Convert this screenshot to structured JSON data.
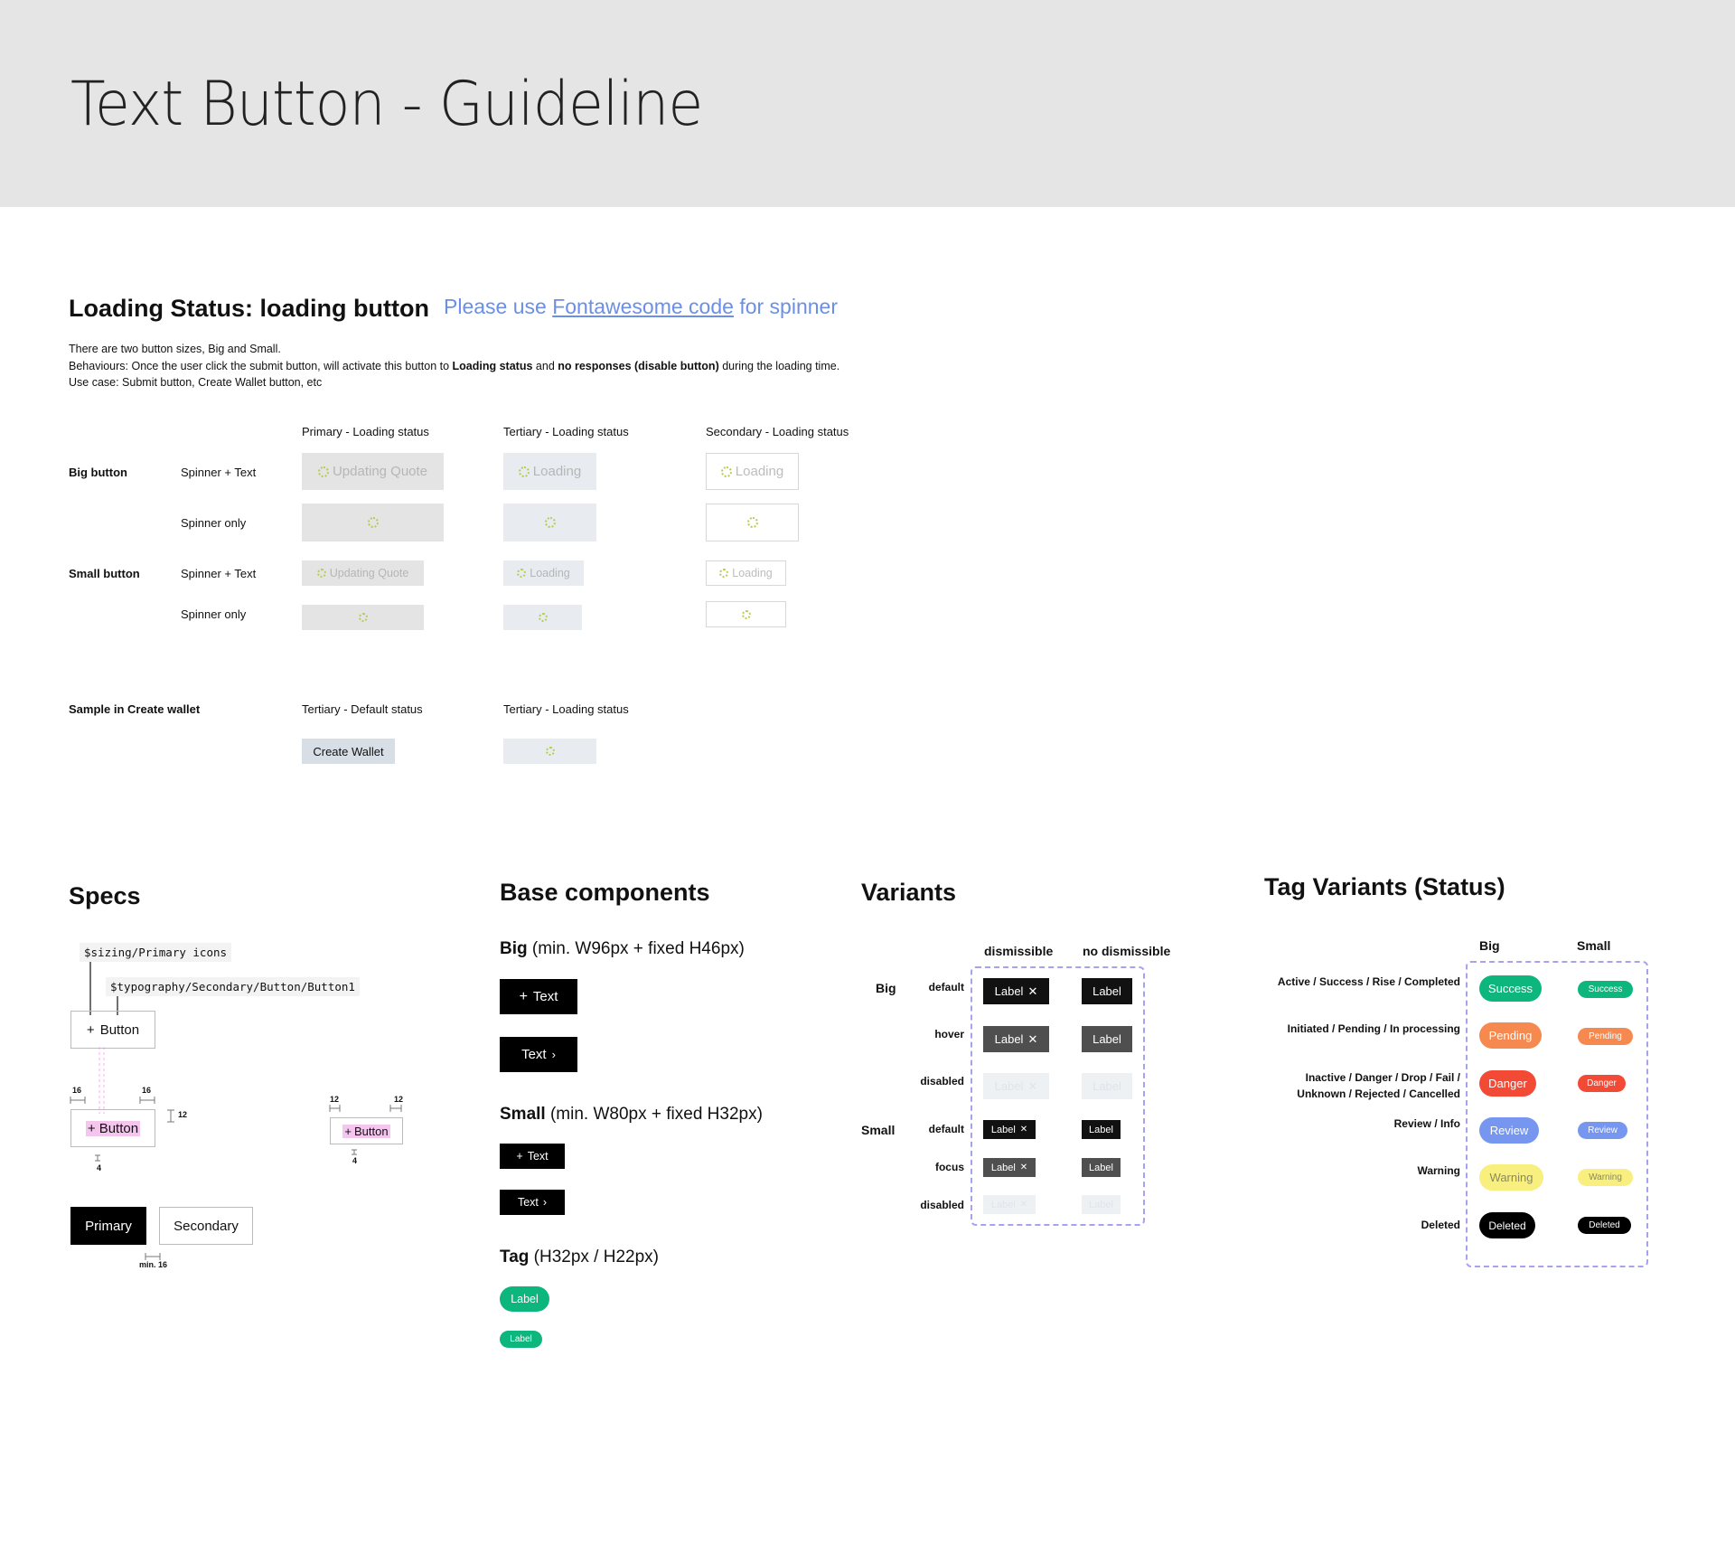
{
  "page_title": "Text Button - Guideline",
  "loading": {
    "title": "Loading Status: loading button",
    "note_prefix": "Please use ",
    "note_link": "Fontawesome code",
    "note_suffix": " for spinner",
    "desc1": "There are two button sizes, Big and Small.",
    "desc2_a": "Behaviours: Once the user click the submit button, will activate this button to ",
    "desc2_b": "Loading status",
    "desc2_c": " and ",
    "desc2_d": "no responses (disable button)",
    "desc2_e": " during the loading time.",
    "desc3": "Use case: Submit button, Create Wallet button, etc",
    "col_primary": "Primary - Loading status",
    "col_tertiary": "Tertiary - Loading status",
    "col_secondary": "Secondary - Loading status",
    "big_button": "Big button",
    "small_button": "Small button",
    "spinner_text": "Spinner + Text",
    "spinner_only": "Spinner only",
    "updating_quote": "Updating Quote",
    "loading_label": "Loading",
    "sample_label": "Sample in Create wallet",
    "col_tertiary_default": "Tertiary - Default status",
    "col_tertiary_loading": "Tertiary - Loading status",
    "create_wallet": "Create Wallet"
  },
  "specs": {
    "title": "Specs",
    "token_icons": "$sizing/Primary icons",
    "token_typography": "$typography/Secondary/Button/Button1",
    "button_label": "Button",
    "plus": "+",
    "dim_16": "16",
    "dim_12": "12",
    "dim_4": "4",
    "primary": "Primary",
    "secondary": "Secondary",
    "min16": "min. 16"
  },
  "base": {
    "title": "Base components",
    "big_title": "Big",
    "big_note": " (min. W96px + fixed H46px)",
    "small_title": "Small",
    "small_note": " (min. W80px + fixed H32px)",
    "tag_title": "Tag",
    "tag_note": " (H32px / H22px)",
    "text": "Text",
    "plus_text": "Text",
    "label": "Label"
  },
  "variants": {
    "title": "Variants",
    "dismissible": "dismissible",
    "no_dismissible": "no dismissible",
    "big": "Big",
    "small": "Small",
    "default": "default",
    "hover": "hover",
    "disabled": "disabled",
    "focus": "focus",
    "label": "Label"
  },
  "tags": {
    "title": "Tag Variants (Status)",
    "big": "Big",
    "small": "Small",
    "rows": [
      {
        "desc": "Active / Success / Rise / Completed",
        "label": "Success",
        "bg": "#0db67c",
        "fg": "#ffffff"
      },
      {
        "desc": "Initiated / Pending / In processing",
        "label": "Pending",
        "bg": "#f5894f",
        "fg": "#ffffff"
      },
      {
        "desc": "Inactive / Danger / Drop / Fail /",
        "desc2": "Unknown / Rejected / Cancelled",
        "label": "Danger",
        "bg": "#f24a35",
        "fg": "#ffffff"
      },
      {
        "desc": "Review / Info",
        "label": "Review",
        "bg": "#7696ef",
        "fg": "#ffffff"
      },
      {
        "desc": "Warning",
        "label": "Warning",
        "bg": "#f8ef7e",
        "fg": "#8a8a5a"
      },
      {
        "desc": "Deleted",
        "label": "Deleted",
        "bg": "#000000",
        "fg": "#ffffff"
      }
    ]
  },
  "icons": {
    "plus": "plus-icon",
    "close": "close-icon",
    "chevron": "chevron-right-icon",
    "spinner": "spinner-icon"
  },
  "colors": {
    "header_bg": "#e5e5e5",
    "link": "#6b8fe6",
    "dash": "#a6a2ee",
    "spinner": "#b5cc52",
    "success": "#0db67c"
  }
}
